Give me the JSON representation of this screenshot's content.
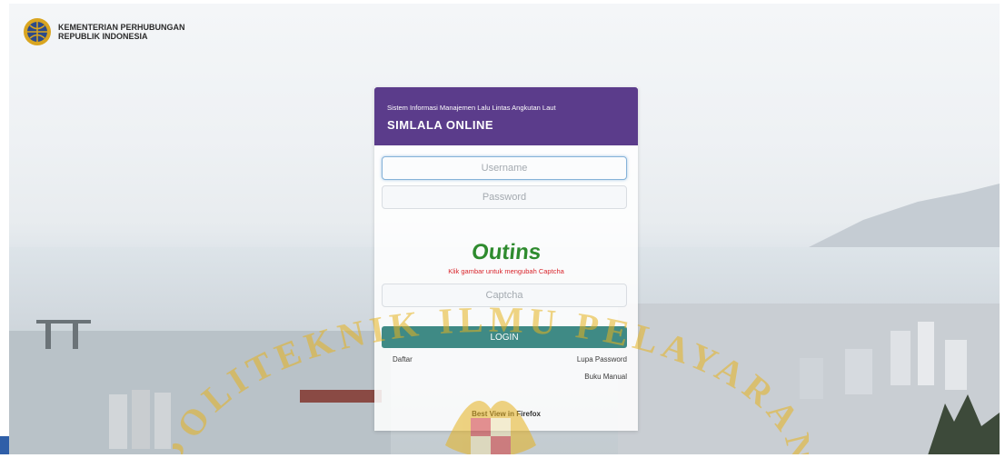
{
  "brand": {
    "line1": "KEMENTERIAN PERHUBUNGAN",
    "line2": "REPUBLIK INDONESIA"
  },
  "login": {
    "subtitle": "Sistem Informasi Manajemen Lalu Lintas Angkutan Laut",
    "title": "SIMLALA ONLINE",
    "username_placeholder": "Username",
    "password_placeholder": "Password",
    "captcha_text": "Outins",
    "captcha_hint": "Klik gambar untuk mengubah Captcha",
    "captcha_placeholder": "Captcha",
    "login_label": "LOGIN",
    "register_label": "Daftar",
    "forgot_label": "Lupa Password",
    "manual_label": "Buku Manual",
    "footer_note": "Best View in Firefox"
  },
  "watermark": {
    "text": "POLITEKNIK ILMU PELAYARAN"
  },
  "colors": {
    "header": "#5b3c8b",
    "login_button": "#3f8a85",
    "captcha_text": "#2e8b2e",
    "captcha_hint": "#d9252b",
    "watermark": "#e6b21f"
  }
}
